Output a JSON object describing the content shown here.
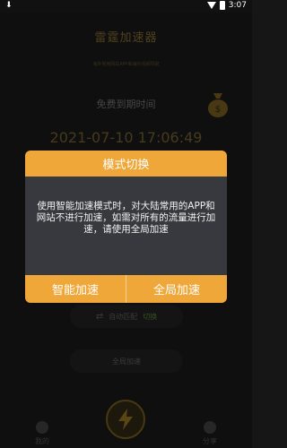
{
  "status_bar": {
    "time": "3:07"
  },
  "app": {
    "title": "雷霆加速器",
    "subtitle": "海外常用网站APP和海外视频导航",
    "free_label": "免费到期时间",
    "expire_time": "2021-07-10 17:06:49",
    "mode_auto": "自动匹配",
    "mode_switch": "切换",
    "global_button": "全局加速"
  },
  "bottom_nav": {
    "mine": "我的",
    "share": "分享"
  },
  "dialog": {
    "title": "模式切换",
    "message": "使用智能加速模式时，对大陆常用的APP和网站不进行加速，如需对所有的流量进行加速，请使用全局加速",
    "smart_button": "智能加速",
    "global_button": "全局加速"
  },
  "colors": {
    "accent": "#efa73a",
    "dialog_bg": "#37393f",
    "switch": "#4c7a33"
  }
}
